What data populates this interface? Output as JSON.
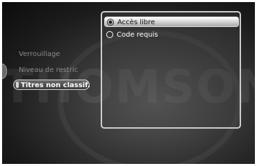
{
  "menu": {
    "items": [
      {
        "label": "Verrouillage"
      },
      {
        "label": "Niveau de restric"
      },
      {
        "label": "Titres non classif."
      }
    ]
  },
  "panel": {
    "options": [
      {
        "label": "Accès libre",
        "selected": true
      },
      {
        "label": "Code requis",
        "selected": false
      }
    ]
  },
  "colors": {
    "highlight": "#d8d8d8",
    "text_dim": "#8a8a8a",
    "text_bright": "#ffffff"
  }
}
